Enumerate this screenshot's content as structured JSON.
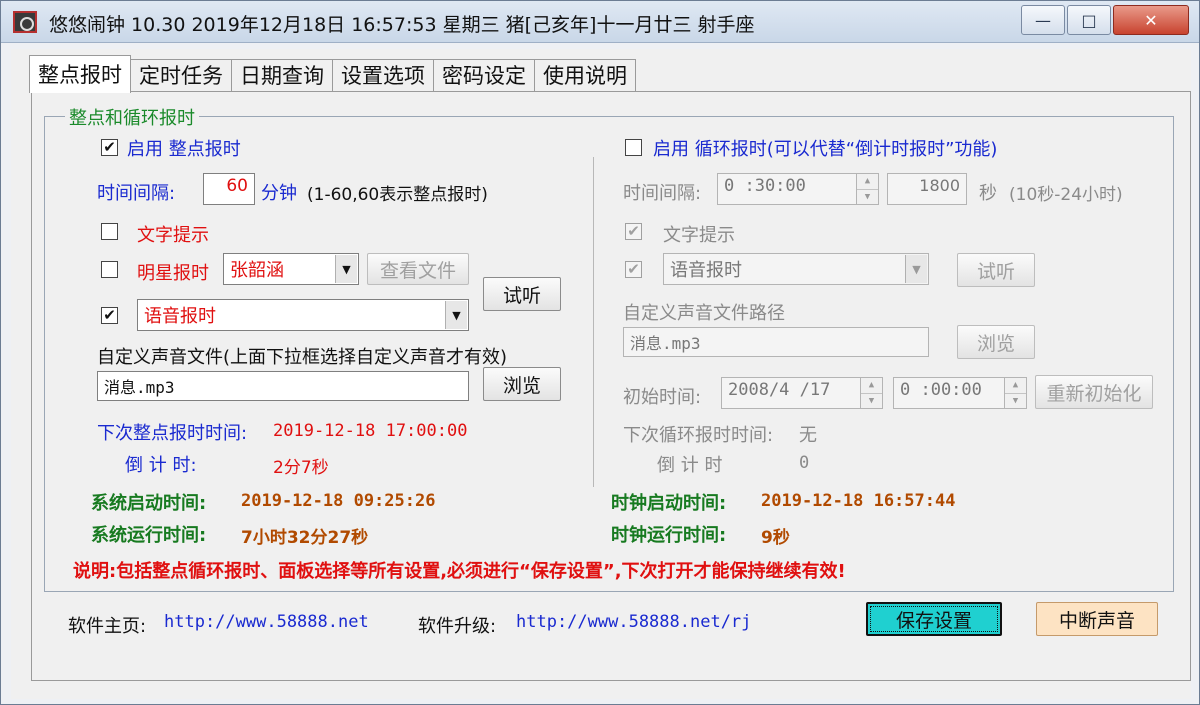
{
  "window": {
    "title": "悠悠闹钟 10.30 2019年12月18日 16:57:53 星期三 猪[己亥年]十一月廿三 射手座",
    "min_glyph": "—",
    "max_glyph": "□",
    "close_glyph": "✕"
  },
  "tabs": [
    "整点报时",
    "定时任务",
    "日期查询",
    "设置选项",
    "密码设定",
    "使用说明"
  ],
  "group_title": "整点和循环报时",
  "left": {
    "enable_label": "启用 整点报时",
    "interval_label": "时间间隔:",
    "interval_value": "60",
    "interval_unit": "分钟",
    "interval_hint": "(1-60,60表示整点报时)",
    "text_prompt_label": "文字提示",
    "star_label": "明星报时",
    "star_select": "张韶涵",
    "view_file_button": "查看文件",
    "listen_button": "试听",
    "voice_select": "语音报时",
    "custom_sound_label": "自定义声音文件(上面下拉框选择自定义声音才有效)",
    "custom_sound_file": "消息.mp3",
    "browse_button": "浏览",
    "next_label": "下次整点报时时间:",
    "next_value": "2019-12-18 17:00:00",
    "countdown_label": "倒 计 时:",
    "countdown_value": "2分7秒",
    "boot_label": "系统启动时间:",
    "boot_value": "2019-12-18 09:25:26",
    "uptime_label": "系统运行时间:",
    "uptime_value": "7小时32分27秒",
    "check_glyph": "✔"
  },
  "right": {
    "enable_label": "启用 循环报时(可以代替“倒计时报时”功能)",
    "interval_label": "时间间隔:",
    "interval_time": "0 :30:00",
    "interval_seconds": "1800",
    "interval_unit": "秒",
    "interval_hint": "(10秒-24小时)",
    "text_prompt_label": "文字提示",
    "voice_select": "语音报时",
    "listen_button": "试听",
    "custom_path_label": "自定义声音文件路径",
    "custom_path_value": "消息.mp3",
    "browse_button": "浏览",
    "init_label": "初始时间:",
    "init_date": "2008/4 /17",
    "init_time": "0 :00:00",
    "reinit_button": "重新初始化",
    "next_label": "下次循环报时时间:",
    "next_value": "无",
    "countdown_label": "倒 计 时",
    "countdown_value": "0",
    "clock_start_label": "时钟启动时间:",
    "clock_start_value": "2019-12-18 16:57:44",
    "clock_run_label": "时钟运行时间:",
    "clock_run_value": "9秒"
  },
  "notice": "说明:包括整点循环报时、面板选择等所有设置,必须进行“保存设置”,下次打开才能保持继续有效!",
  "footer": {
    "homepage_label": "软件主页:",
    "homepage_url": "http://www.58888.net",
    "upgrade_label": "软件升级:",
    "upgrade_url": "http://www.58888.net/rj",
    "save_button": "保存设置",
    "stop_button": "中断声音"
  },
  "colors": {
    "group_title": "#1a8a2a",
    "blue_text": "#1a2ad0",
    "red_text": "#e01010",
    "green_label": "#177a20",
    "brown_value": "#b14a00",
    "save_button_bg": "#1fd0d0",
    "stop_button_bg": "#fde3c3"
  }
}
